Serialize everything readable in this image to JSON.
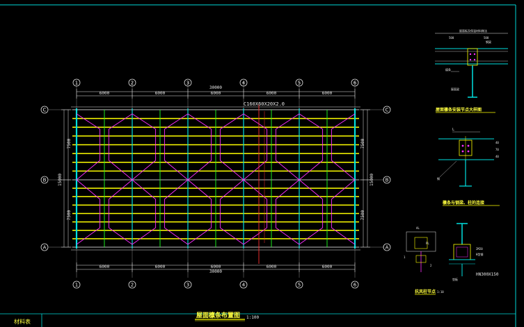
{
  "title": {
    "main": "屋面檩条布置图",
    "scale": "1:100"
  },
  "bottom_label": "材料表",
  "axes": {
    "numbers": [
      "1",
      "2",
      "3",
      "4",
      "5",
      "6"
    ],
    "letters_top_to_bottom": [
      "C",
      "B",
      "A"
    ]
  },
  "dimensions": {
    "top_overall": "30000",
    "top_bays": [
      "6000",
      "6000",
      "6000",
      "6000",
      "6000"
    ],
    "bottom_overall": "30000",
    "bottom_bays": [
      "6000",
      "6000",
      "6000",
      "6000",
      "6000"
    ],
    "left_overall": "15000",
    "left_bays": [
      "7500",
      "7500"
    ],
    "right_overall": "15000",
    "right_bays": [
      "7500",
      "7500"
    ]
  },
  "purlin_label": "C160X60X20X2.0",
  "details": {
    "d1": {
      "title": "屋面檩条安装节点大样图",
      "dims": [
        "500",
        "500"
      ],
      "top_note": "屋面板及保温材料做法",
      "label_a": "檩条",
      "label_b": "钢梁",
      "label_c": "屋面梁"
    },
    "d2": {
      "title": "檩条与钢梁、柱的连接",
      "dim_l": "L",
      "side_dims": [
        "40",
        "70",
        "40"
      ],
      "label": "钢"
    },
    "d3": {
      "title": "抗风柱节点",
      "scale": "1:10",
      "label_hn": "HN300X150",
      "label_bolt": "2M20",
      "label_plate": "H型钢",
      "label_bot": "垫板",
      "small_labels": [
        "AL",
        "PL",
        "1",
        "2"
      ]
    }
  },
  "colors": {
    "cyan": "#00e0e0",
    "yellow": "#ffff00",
    "magenta": "#ff30ff",
    "green": "#20ff20",
    "red": "#ff3030",
    "white": "#e8e8e8"
  }
}
